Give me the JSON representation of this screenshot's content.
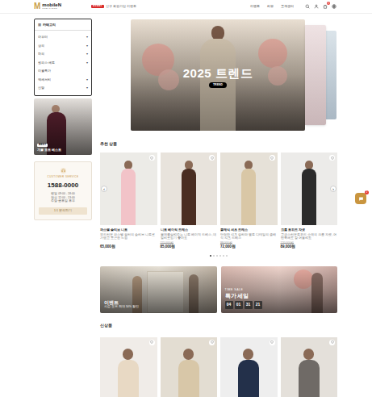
{
  "header": {
    "logo_mark": "M",
    "logo": "mobileN",
    "logo_sub": "CREATIONS",
    "promo_badge": "EVENT",
    "promo_text": "신규 회원가입 이벤트",
    "nav": [
      "이벤트",
      "리뷰",
      "고객센터"
    ],
    "cart_count": "0"
  },
  "sidebar": {
    "title": "카테고리",
    "title_icon": "☰",
    "expand_icon": "▾",
    "items": [
      {
        "label": "아우터",
        "expandable": true
      },
      {
        "label": "상의",
        "expandable": true
      },
      {
        "label": "하의",
        "expandable": true
      },
      {
        "label": "원피스·세트",
        "expandable": true
      },
      {
        "label": "이월특가",
        "expandable": false
      },
      {
        "label": "액세서리",
        "expandable": true
      },
      {
        "label": "신발",
        "expandable": true
      }
    ],
    "best": {
      "badge": "BEST",
      "caption": "겨울 코트 베스트"
    },
    "service": {
      "label": "CUSTOMER SERVICE",
      "phone": "1588-0000",
      "hours": [
        "평일 09:00 - 18:00",
        "점심 12:00 - 13:00",
        "주말·공휴일 휴무"
      ],
      "button": "1:1 문의하기"
    }
  },
  "hero": {
    "title": "2025 트렌드",
    "button": "TREND"
  },
  "recommended": {
    "title": "추천 상품",
    "prev": "‹",
    "next": "›",
    "products": [
      {
        "name": "파스텔 슬리브 니트",
        "desc": "부드러운 파스텔 컬러의 슬리브 니트로 가볍고 포근한 느낌",
        "price": "65,000원",
        "wished": false
      },
      {
        "name": "니트 베이직 드레스",
        "desc": "몸매를 살려주는 니트 베이직 드레스, 데일리로 입기 좋아요",
        "old_price": "115,000원",
        "price": "85,000원",
        "wished": false
      },
      {
        "name": "클래식 셔츠 드레스",
        "desc": "단정한 셔츠 칼라와 벨트 디테일의 클래식 셔츠 드레스",
        "old_price": "98,000원",
        "price": "72,000원",
        "wished": false
      },
      {
        "name": "크롭 트위드 자켓",
        "desc": "고급스러운 트위드 소재의 크롭 자켓, 어떤 룩에도 잘 어울려요",
        "old_price": "120,000원",
        "price": "89,000원",
        "wished": false
      }
    ],
    "dots": [
      {
        "selected": true
      },
      {
        "selected": false
      },
      {
        "selected": false
      },
      {
        "selected": false
      },
      {
        "selected": false
      },
      {
        "selected": false
      }
    ]
  },
  "banners": {
    "event": {
      "title": "이벤트",
      "subtitle": "시즌 오프 최대 50% 할인"
    },
    "sale": {
      "tag": "TIME SALE",
      "title": "특가 세일",
      "countdown": [
        "04",
        "01",
        "31",
        "21"
      ]
    }
  },
  "new_products": {
    "title": "신상품",
    "items": [
      {
        "wished": false
      },
      {
        "wished": false
      },
      {
        "wished": false
      },
      {
        "wished": false
      }
    ]
  },
  "chat": {
    "badge": "2"
  }
}
